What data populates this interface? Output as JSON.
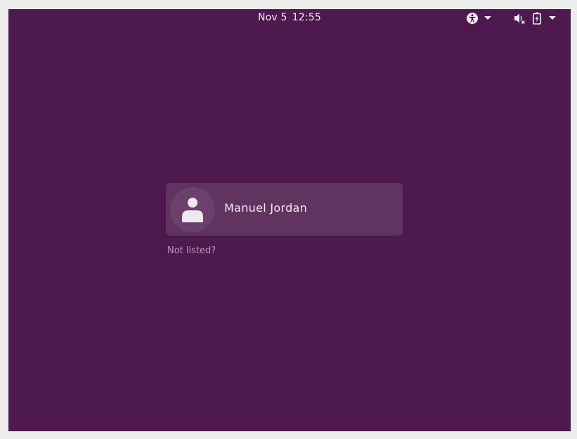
{
  "top_bar": {
    "date": "Nov 5",
    "time": "12:55",
    "accessibility_icon": "accessibility-icon",
    "volume_icon": "volume-muted-icon",
    "battery_icon": "battery-charging-icon"
  },
  "login": {
    "users": [
      {
        "name": "Manuel Jordan",
        "avatar_icon": "user-icon"
      }
    ],
    "not_listed_label": "Not listed?"
  },
  "colors": {
    "background": "#4e194e",
    "card": "#613361",
    "frame": "#eeedee"
  }
}
